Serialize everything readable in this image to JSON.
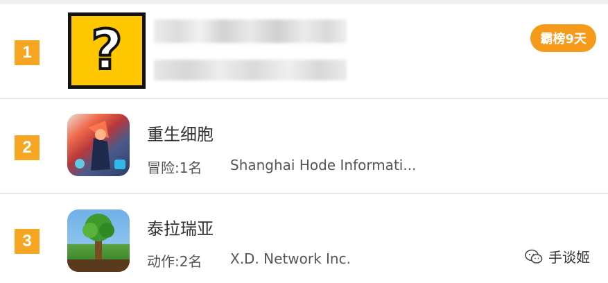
{
  "entries": [
    {
      "rank": "1",
      "title": "",
      "category_rank": "",
      "developer": "",
      "streak_label": "霸榜9天",
      "icon": "question-mark-icon"
    },
    {
      "rank": "2",
      "title": "重生细胞",
      "category_rank": "冒险:1名",
      "developer": "Shanghai Hode Informati...",
      "icon": "dead-cells-icon"
    },
    {
      "rank": "3",
      "title": "泰拉瑞亚",
      "category_rank": "动作:2名",
      "developer": "X.D. Network Inc.",
      "icon": "terraria-icon"
    }
  ],
  "mystery_symbol": "?",
  "watermark": {
    "text": "手谈姬",
    "icon": "wechat-icon"
  },
  "colors": {
    "rank_badge": "#f6a623",
    "streak_badge": "#f59a1a",
    "divider": "#e4e6ea"
  }
}
